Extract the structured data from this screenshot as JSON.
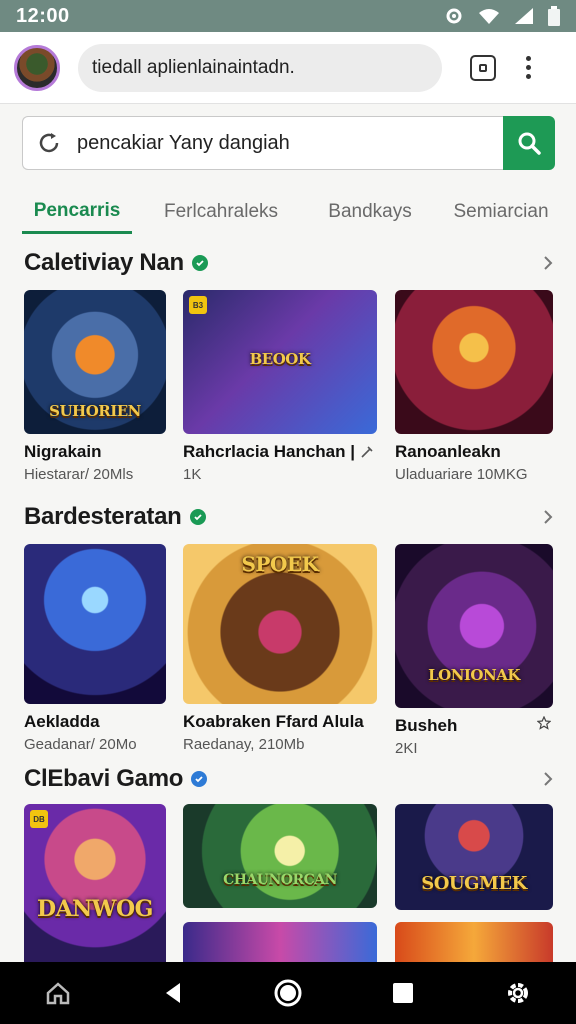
{
  "status_bar": {
    "time": "12:00",
    "icons": [
      "settings-gear-icon",
      "wifi-icon",
      "signal-icon",
      "battery-icon"
    ]
  },
  "browser": {
    "url": "tiedall aplienlainaintadn.",
    "tab_icon": "tabs-icon",
    "menu_icon": "more-vert-icon"
  },
  "search": {
    "value": "pencakiar Yany dangiah",
    "icon": "refresh-icon",
    "button_icon": "search-icon",
    "accent": "#1e9a55"
  },
  "tabs": [
    {
      "label": "Pencarris",
      "active": true
    },
    {
      "label": "Ferlcahraleks",
      "active": false
    },
    {
      "label": "Bandkays",
      "active": false
    },
    {
      "label": "Semiarcian",
      "active": false
    }
  ],
  "sections": [
    {
      "title": "Caletiviay Nan",
      "verified_color": "#1a9a55",
      "cards": [
        {
          "thumb_title": "SUHORIEN",
          "name": "Nigrakain",
          "meta": "Hiestarar/ 20Mls",
          "badge": "",
          "icon": ""
        },
        {
          "thumb_title": "BEOOK",
          "name": "Rahcrlacia Hanchan |",
          "meta": "1K",
          "badge": "B3",
          "icon": "pin-icon"
        },
        {
          "thumb_title": "",
          "name": "Ranoanleakn",
          "meta": "Uladuariare 10MKG",
          "badge": "",
          "icon": ""
        }
      ]
    },
    {
      "title": "Bardesteratan",
      "verified_color": "#1a9a55",
      "cards": [
        {
          "thumb_title": "",
          "name": "Aekladda",
          "meta": "Geadanar/ 20Mo",
          "badge": "",
          "icon": ""
        },
        {
          "thumb_title": "SPOEK",
          "name": "Koabraken Ffard Alula",
          "meta": "Raedanay, 210Mb",
          "badge": "",
          "icon": ""
        },
        {
          "thumb_title": "LONIONAK",
          "name": "Busheh",
          "meta": "2KI",
          "badge": "",
          "icon": "star-icon"
        }
      ]
    },
    {
      "title": "ClEbavi Gamo",
      "verified_color": "#2e7bd6",
      "cards": [
        {
          "thumb_title": "DANWOG",
          "name": "",
          "meta": "",
          "badge": "DB",
          "icon": ""
        },
        {
          "thumb_title": "CHAUNORCAN",
          "name": "",
          "meta": "",
          "badge": "",
          "icon": ""
        },
        {
          "thumb_title": "SOUGMEK",
          "name": "",
          "meta": "",
          "badge": "",
          "icon": ""
        }
      ]
    }
  ],
  "nav": [
    "home-icon",
    "back-icon",
    "home-circle-icon",
    "recents-icon",
    "settings-icon"
  ]
}
